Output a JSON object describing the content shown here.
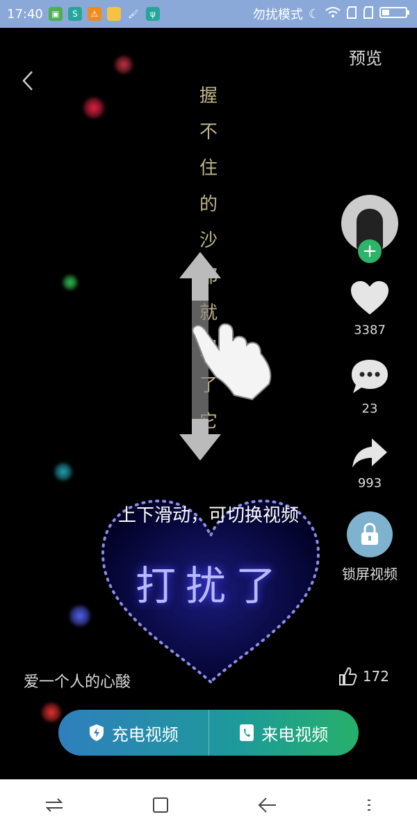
{
  "status_bar": {
    "time": "17:40",
    "dnd_label": "勿扰模式"
  },
  "header": {
    "preview_label": "预览"
  },
  "video": {
    "vertical_text": [
      "握",
      "不",
      "住",
      "的",
      "沙",
      "",
      "都",
      "就",
      "揚",
      "了",
      "它"
    ],
    "heart_text": "打扰了",
    "swipe_hint": "上下滑动，可切换视频",
    "title": "爱一个人的心酸",
    "likes_count": "172"
  },
  "side_actions": {
    "like_count": "3387",
    "comment_count": "23",
    "share_count": "993",
    "lock_label": "锁屏视频"
  },
  "bottom_actions": {
    "charge_label": "充电视频",
    "call_label": "来电视频"
  },
  "colors": {
    "status_bar_bg": "#8aa9d8",
    "follow_green": "#2db469",
    "action_gradient_start": "#2f7fbd",
    "action_gradient_end": "#27b06b"
  }
}
